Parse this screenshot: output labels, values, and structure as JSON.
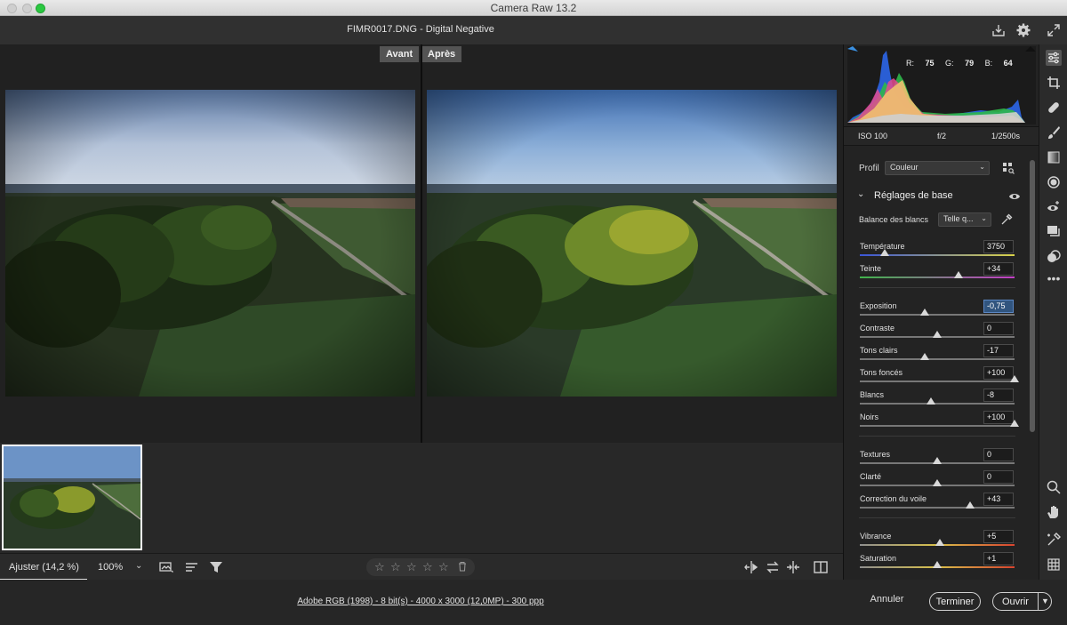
{
  "app": {
    "title": "Camera Raw 13.2"
  },
  "document": {
    "title": "FIMR0017.DNG  -  Digital Negative"
  },
  "compare": {
    "before": "Avant",
    "after": "Après"
  },
  "bottombar": {
    "zoom_fit": "Ajuster (14,2 %)",
    "zoom_pct": "100%"
  },
  "statusbar": {
    "info": "Adobe RGB (1998) - 8 bit(s) - 4000 x 3000 (12,0MP) - 300 ppp",
    "cancel": "Annuler",
    "done": "Terminer",
    "open": "Ouvrir"
  },
  "histogram": {
    "r_label": "R:",
    "r": "75",
    "g_label": "G:",
    "g": "79",
    "b_label": "B:",
    "b": "64"
  },
  "exif": {
    "iso": "ISO 100",
    "aperture": "f/2",
    "shutter": "1/2500s"
  },
  "profile": {
    "label": "Profil",
    "value": "Couleur"
  },
  "basic": {
    "title": "Réglages de base",
    "wb_label": "Balance des blancs",
    "wb_value": "Telle q...",
    "sliders": [
      {
        "label": "Température",
        "value": "3750",
        "pos": 0.16,
        "track": "temp"
      },
      {
        "label": "Teinte",
        "value": "+34",
        "pos": 0.64,
        "track": "tint"
      },
      {
        "label": "Exposition",
        "value": "-0,75",
        "pos": 0.42,
        "track": "plain",
        "active": true
      },
      {
        "label": "Contraste",
        "value": "0",
        "pos": 0.5,
        "track": "plain"
      },
      {
        "label": "Tons clairs",
        "value": "-17",
        "pos": 0.42,
        "track": "plain"
      },
      {
        "label": "Tons foncés",
        "value": "+100",
        "pos": 1.0,
        "track": "plain"
      },
      {
        "label": "Blancs",
        "value": "-8",
        "pos": 0.46,
        "track": "plain"
      },
      {
        "label": "Noirs",
        "value": "+100",
        "pos": 1.0,
        "track": "plain"
      },
      {
        "label": "Textures",
        "value": "0",
        "pos": 0.5,
        "track": "plain"
      },
      {
        "label": "Clarté",
        "value": "0",
        "pos": 0.5,
        "track": "plain"
      },
      {
        "label": "Correction du voile",
        "value": "+43",
        "pos": 0.71,
        "track": "plain"
      },
      {
        "label": "Vibrance",
        "value": "+5",
        "pos": 0.52,
        "track": "sat"
      },
      {
        "label": "Saturation",
        "value": "+1",
        "pos": 0.5,
        "track": "sat"
      }
    ]
  },
  "icons": {
    "tools": [
      "edit-sliders-icon",
      "crop-icon",
      "heal-icon",
      "brush-icon",
      "gradient-icon",
      "radial-icon",
      "red-eye-icon",
      "snapshots-icon",
      "presets-icon",
      "more-icon",
      "zoom-icon",
      "hand-icon",
      "color-sampler-icon",
      "grid-icon"
    ]
  }
}
